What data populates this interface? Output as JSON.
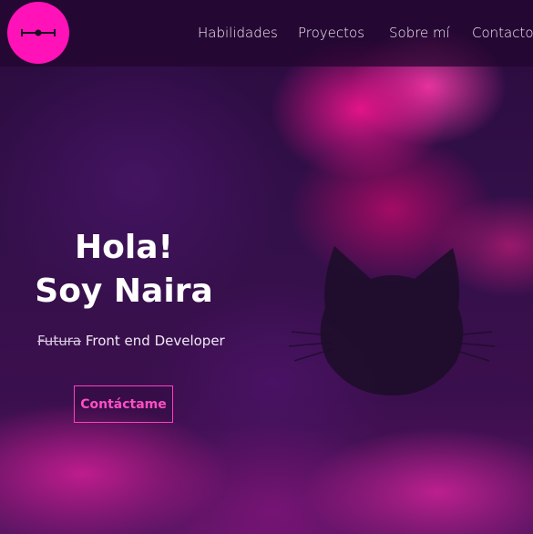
{
  "navbar": {
    "logo_icon": "barbell-line-icon",
    "links": [
      "Habilidades",
      "Proyectos",
      "Sobre mí",
      "Contacto"
    ]
  },
  "hero": {
    "line1": "Hola!",
    "line2": "Soy Naira",
    "subtitle_struck": "Futura",
    "subtitle_rest": "Front end Developer",
    "cta_label": "Contáctame",
    "illustration_icon": "cat-silhouette-icon"
  },
  "colors": {
    "accent": "#ff12b8",
    "cta_text": "#ff4fc4",
    "background": "#2a0b3f"
  }
}
